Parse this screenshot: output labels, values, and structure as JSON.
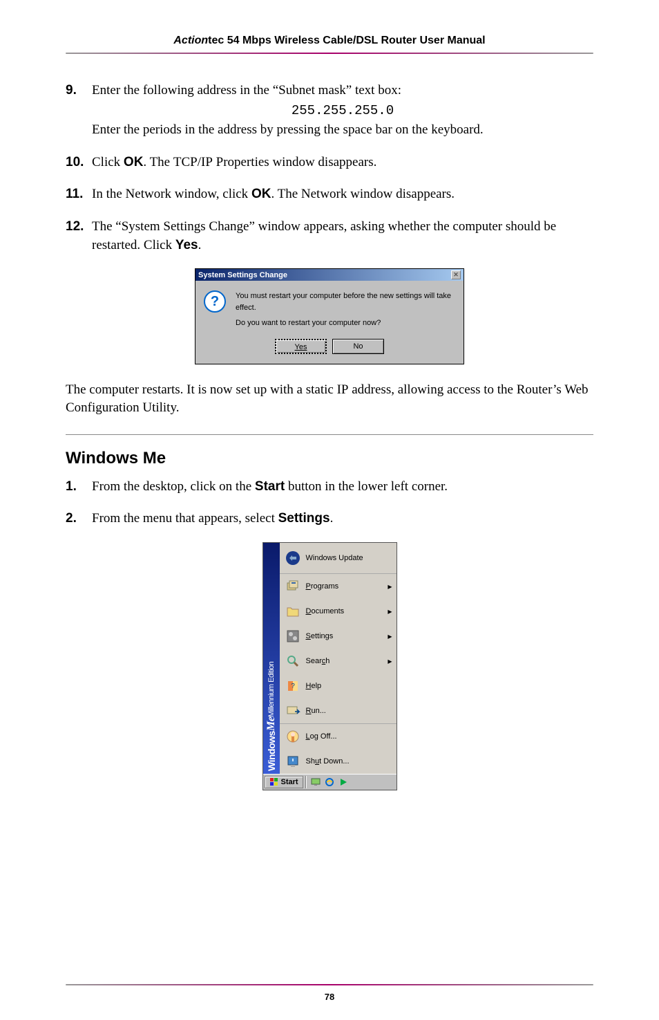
{
  "header": {
    "brand_italic": "Action",
    "brand_rest": "tec 54 Mbps Wireless Cable/DSL Router User Manual"
  },
  "steps_part1": [
    {
      "num": "9.",
      "line1": "Enter the following address in the “Subnet mask” text box:",
      "code": "255.255.255.0",
      "line2": "Enter the periods in the address by pressing the space bar on the keyboard."
    },
    {
      "num": "10.",
      "text_before": "Click ",
      "bold": "OK",
      "text_mid": ". The ",
      "sc": "TCP/IP",
      "text_after": " Properties window disappears."
    },
    {
      "num": "11.",
      "text_before": "In the Network window, click ",
      "bold": "OK",
      "text_after": ". The Network window disappears."
    },
    {
      "num": "12.",
      "text_before": "The “System Settings Change” window appears, asking whether the computer should be restarted. Click ",
      "bold": "Yes",
      "text_after": "."
    }
  ],
  "dialog": {
    "title": "System Settings Change",
    "line1": "You must restart your computer before the new settings will take effect.",
    "line2": "Do you want to restart your computer now?",
    "yes": "Yes",
    "no": "No"
  },
  "body_after_dialog": {
    "text_before": "The computer restarts. It is now set up with a static ",
    "sc": "IP",
    "text_after": " address, allowing access to the Router’s Web Configuration Utility."
  },
  "section_heading": "Windows Me",
  "steps_part2": [
    {
      "num": "1.",
      "text_before": "From the desktop, click on the ",
      "bold": "Start",
      "text_after": " button in the lower left corner."
    },
    {
      "num": "2.",
      "text_before": "From the menu that appears, select ",
      "bold": "Settings",
      "text_after": "."
    }
  ],
  "startmenu": {
    "side_text": "Windows",
    "side_me": "Me",
    "side_edition": " Millennium Edition",
    "items": [
      {
        "label": "Windows Update",
        "arrow": false,
        "top": true
      },
      {
        "label_u": "P",
        "label_rest": "rograms",
        "arrow": true
      },
      {
        "label_u": "D",
        "label_rest": "ocuments",
        "arrow": true
      },
      {
        "label_u": "S",
        "label_rest": "ettings",
        "arrow": true
      },
      {
        "label_rest_pre": "Sear",
        "label_u": "c",
        "label_rest": "h",
        "arrow": true
      },
      {
        "label_u": "H",
        "label_rest": "elp",
        "arrow": false
      },
      {
        "label_u": "R",
        "label_rest": "un...",
        "arrow": false,
        "sep_after": true
      },
      {
        "label_u": "L",
        "label_rest": "og Off...",
        "arrow": false
      },
      {
        "label_rest_pre": "Sh",
        "label_u": "u",
        "label_rest": "t Down...",
        "arrow": false
      }
    ],
    "taskbar": {
      "start": "Start"
    }
  },
  "page_number": "78"
}
